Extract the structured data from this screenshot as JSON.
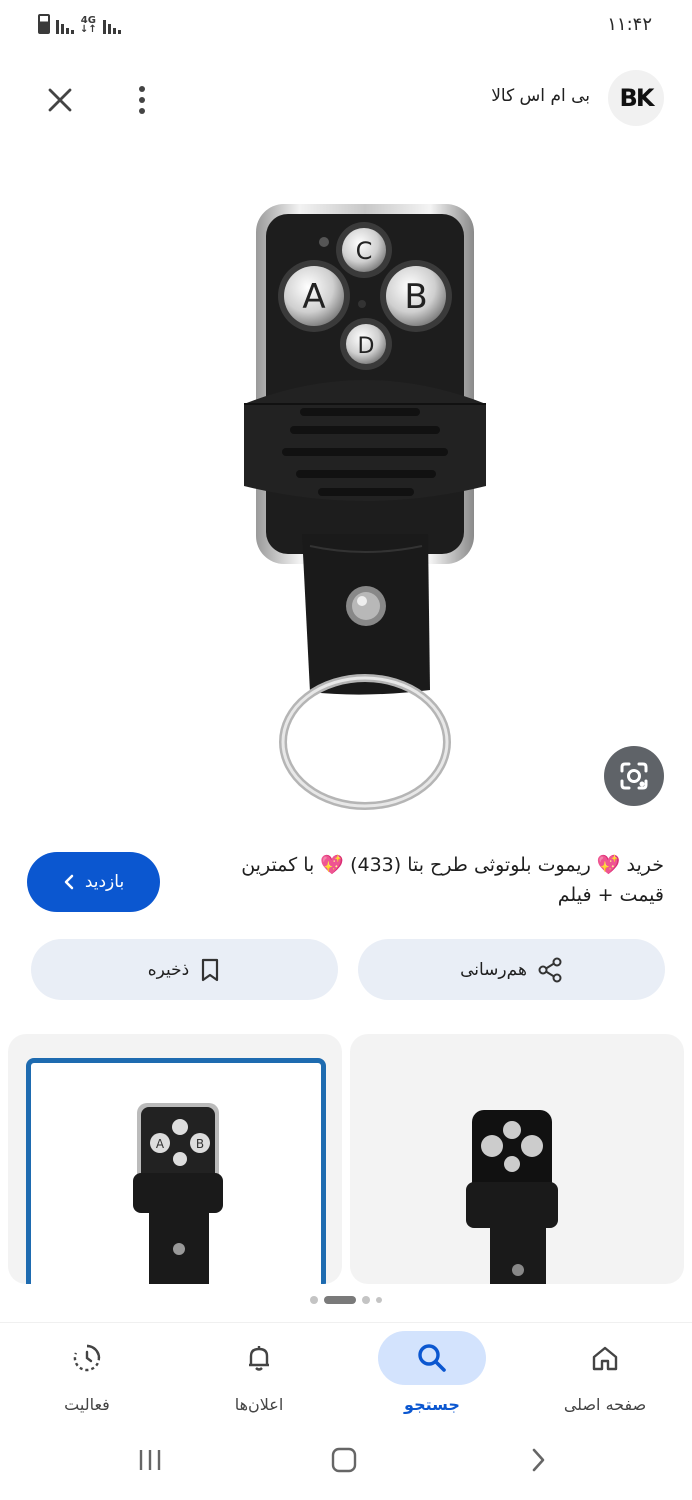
{
  "status_bar": {
    "time": "۱۱:۴۲",
    "network": "4G"
  },
  "header": {
    "site_name": "بی ام اس کالا",
    "logo_text": "BK",
    "close_icon": "close-icon",
    "more_icon": "more-vert-icon"
  },
  "product": {
    "title_line1": "خرید 💖 ریموت بلوتوثی طرح بتا (433) 💖 با کمترین",
    "title_line2": "قیمت + فیلم",
    "visit_label": "بازدید"
  },
  "actions": {
    "share_label": "هم‌رسانی",
    "save_label": "ذخیره"
  },
  "bottom_nav": {
    "items": [
      {
        "label": "صفحه اصلی",
        "icon": "home-icon"
      },
      {
        "label": "جستجو",
        "icon": "search-icon",
        "active": true
      },
      {
        "label": "اعلان‌ها",
        "icon": "bell-icon"
      },
      {
        "label": "فعالیت",
        "icon": "activity-icon"
      }
    ]
  },
  "colors": {
    "accent": "#0b57d0",
    "button_bg": "#e9eef6",
    "active_nav_bg": "#d3e3fd"
  }
}
